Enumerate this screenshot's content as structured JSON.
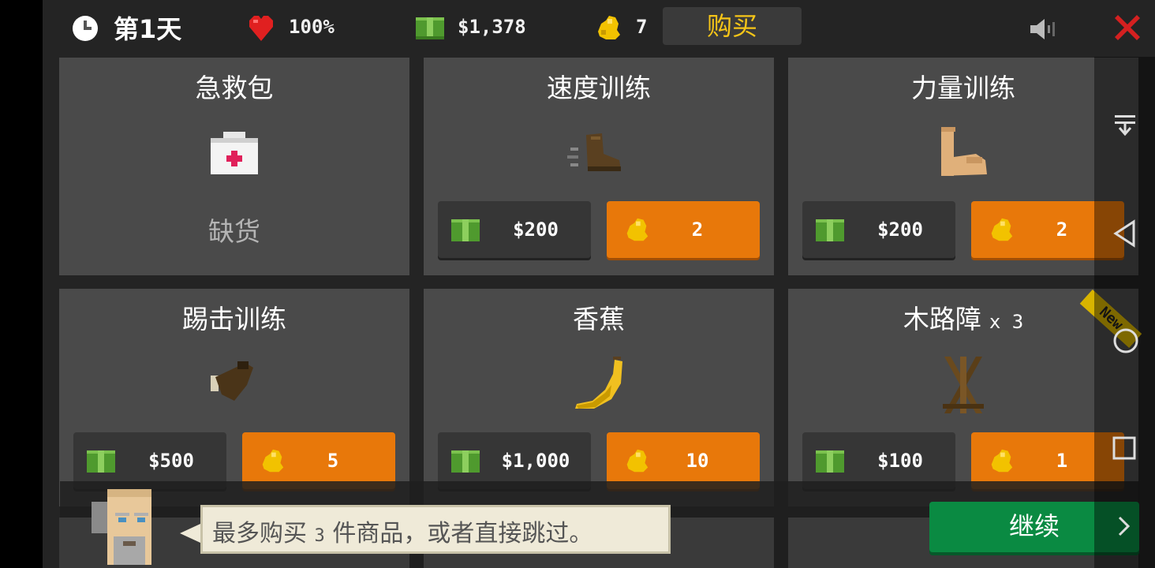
{
  "hud": {
    "day": "第1天",
    "health": "100%",
    "cash": "$1,378",
    "gold": "7",
    "buy_label": "购买",
    "icons": [
      "clock-icon",
      "heart-icon",
      "cash-icon",
      "gold-nugget-icon",
      "speaker-icon",
      "close-icon"
    ]
  },
  "items": [
    {
      "name": "急救包",
      "status": "缺货",
      "icon": "first-aid-kit-icon"
    },
    {
      "name": "速度训练",
      "cash_price": "$200",
      "gold_price": "2",
      "icon": "running-shoe-icon"
    },
    {
      "name": "力量训练",
      "cash_price": "$200",
      "gold_price": "2",
      "icon": "flexed-arm-icon"
    },
    {
      "name": "踢击训练",
      "cash_price": "$500",
      "gold_price": "5",
      "icon": "kick-boot-icon"
    },
    {
      "name": "香蕉",
      "cash_price": "$1,000",
      "gold_price": "10",
      "icon": "banana-icon"
    },
    {
      "name": "木路障",
      "quantity": "x 3",
      "cash_price": "$100",
      "gold_price": "1",
      "icon": "wooden-barricade-icon",
      "badge": "New"
    }
  ],
  "hint": {
    "pre": "最多购买",
    "count": "3",
    "post": "件商品，或者直接跳过。"
  },
  "continue_label": "继续",
  "colors": {
    "background": "#242424",
    "card": "#4a4a4a",
    "gold_button": "#e8780a",
    "cash_button": "#363636",
    "continue_button": "#0a8a42",
    "buy_text": "#f5c518",
    "new_badge": "#d8b400"
  }
}
